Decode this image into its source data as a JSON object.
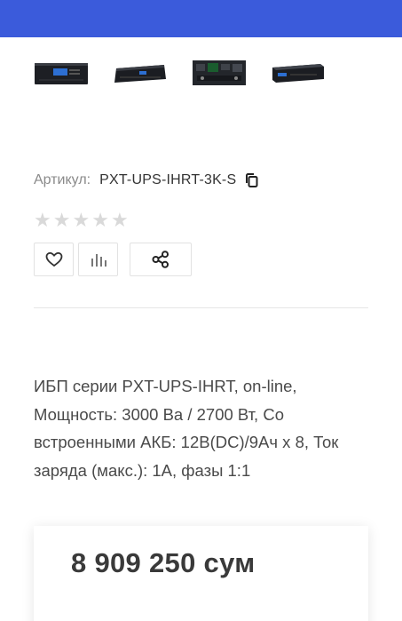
{
  "header": {
    "color": "#3b5bdb"
  },
  "gallery": {
    "thumbnails": [
      {
        "name": "ups-front-display-thumbnail"
      },
      {
        "name": "ups-front-angle-thumbnail"
      },
      {
        "name": "ups-rear-panel-thumbnail"
      },
      {
        "name": "ups-side-angle-thumbnail"
      }
    ]
  },
  "product": {
    "sku_label": "Артикул:",
    "sku_value": "PXT-UPS-IHRT-3K-S",
    "rating": {
      "value": 0,
      "max": 5
    },
    "description": "ИБП серии PXT-UPS-IHRT, on-line, Мощность: 3000 Ва / 2700 Вт, Со встроенными АКБ: 12В(DC)/9Ач х 8, Ток заряда (макс.): 1А, фазы 1:1",
    "price": "8 909 250 сум"
  },
  "actions": {
    "favorite_icon": "heart-icon",
    "compare_icon": "bar-chart-icon",
    "share_icon": "share-icon"
  }
}
